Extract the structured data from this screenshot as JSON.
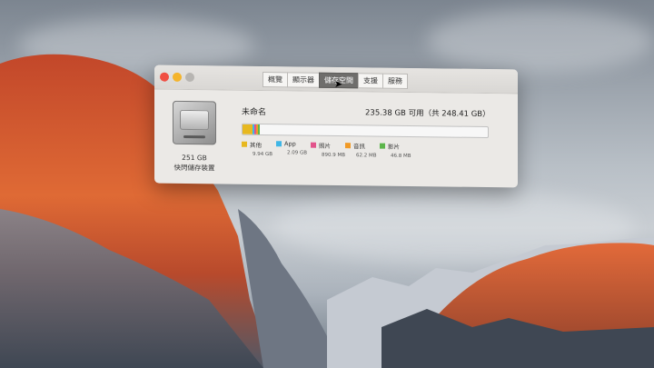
{
  "window": {
    "tabs": [
      {
        "label": "概覽"
      },
      {
        "label": "顯示器"
      },
      {
        "label": "儲存空間"
      },
      {
        "label": "支援"
      },
      {
        "label": "服務"
      }
    ],
    "active_tab": "儲存空間"
  },
  "drive": {
    "size": "251 GB",
    "type": "快閃儲存裝置"
  },
  "volume": {
    "name": "未命名",
    "available": "235.38 GB 可用（共 248.41 GB）"
  },
  "categories": [
    {
      "label": "其他",
      "size": "9.94 GB",
      "color": "#e7b820",
      "fraction": 0.04
    },
    {
      "label": "App",
      "size": "2.09 GB",
      "color": "#3fb6e6",
      "fraction": 0.0084
    },
    {
      "label": "照片",
      "size": "890.9 MB",
      "color": "#e2538b",
      "fraction": 0.0036
    },
    {
      "label": "音訊",
      "size": "62.2 MB",
      "color": "#f19a26",
      "fraction": 0.0003
    },
    {
      "label": "影片",
      "size": "46.8 MB",
      "color": "#5bb54a",
      "fraction": 0.0002
    }
  ],
  "colors": {
    "close": "#f04f43",
    "minimize": "#f4b42b",
    "zoom": "#b7b5b2"
  }
}
